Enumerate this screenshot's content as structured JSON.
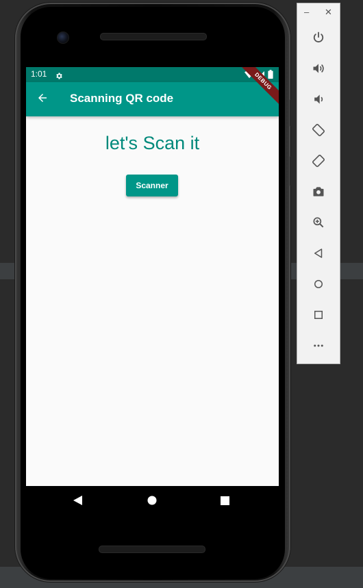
{
  "status_bar": {
    "time": "1:01"
  },
  "app_bar": {
    "title": "Scanning QR code",
    "debug_banner": "DEBUG"
  },
  "content": {
    "headline": "let's Scan it",
    "scanner_button_label": "Scanner"
  },
  "emulator_toolbar": {
    "minimize_label": "–",
    "close_label": "✕",
    "buttons": [
      "power-icon",
      "volume-up-icon",
      "volume-down-icon",
      "rotate-left-icon",
      "rotate-right-icon",
      "camera-icon",
      "zoom-icon",
      "back-icon",
      "home-icon",
      "overview-icon",
      "more-icon"
    ]
  },
  "colors": {
    "app_bar": "#009688",
    "status_bar": "#00796b",
    "headline": "#00897b",
    "screen_bg": "#fafafa",
    "debug_ribbon": "#7a1a1a"
  }
}
